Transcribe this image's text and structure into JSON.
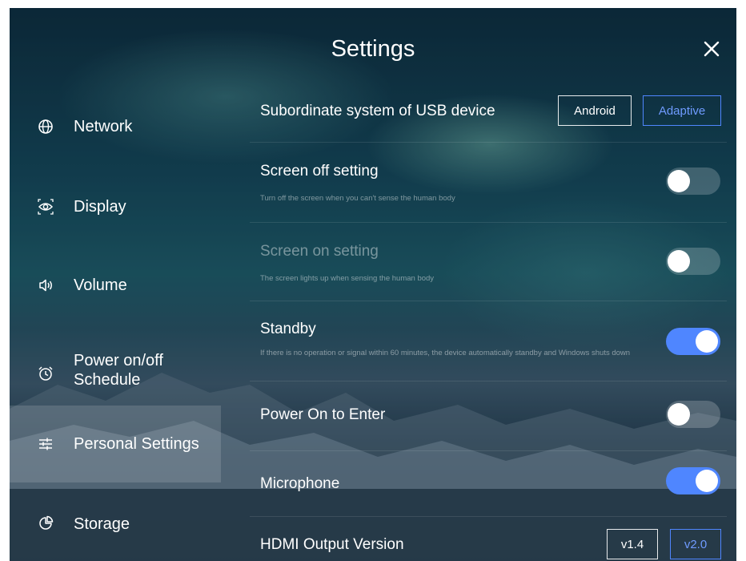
{
  "header": {
    "title": "Settings"
  },
  "sidebar": {
    "items": [
      {
        "label": "Network",
        "icon": "globe-icon"
      },
      {
        "label": "Display",
        "icon": "eye-icon"
      },
      {
        "label": "Volume",
        "icon": "speaker-icon"
      },
      {
        "label": "Power on/off Schedule",
        "icon": "alarm-clock-icon"
      },
      {
        "label": "Personal Settings",
        "icon": "sliders-icon",
        "active": true
      },
      {
        "label": "Storage",
        "icon": "pie-chart-icon"
      }
    ]
  },
  "settings": {
    "usb": {
      "title": "Subordinate system of USB device",
      "options": [
        "Android",
        "Adaptive"
      ],
      "selected": "Adaptive"
    },
    "screen_off": {
      "title": "Screen off setting",
      "subtitle": "Turn off the screen when you can't sense the human body",
      "enabled": false
    },
    "screen_on": {
      "title": "Screen on setting",
      "subtitle": "The screen lights up when sensing the human body",
      "enabled": false
    },
    "standby": {
      "title": "Standby",
      "subtitle": "If there is no operation or signal within 60 minutes, the device automatically standby and Windows shuts down",
      "enabled": true
    },
    "power_on_enter": {
      "title": "Power On to Enter",
      "enabled": false
    },
    "microphone": {
      "title": "Microphone",
      "enabled": true
    },
    "hdmi": {
      "title": "HDMI Output Version",
      "options": [
        "v1.4",
        "v2.0"
      ],
      "selected": "v2.0"
    }
  },
  "colors": {
    "accent": "#4f86ff",
    "toggle_off": "#5a6b75",
    "text": "#ffffff"
  }
}
